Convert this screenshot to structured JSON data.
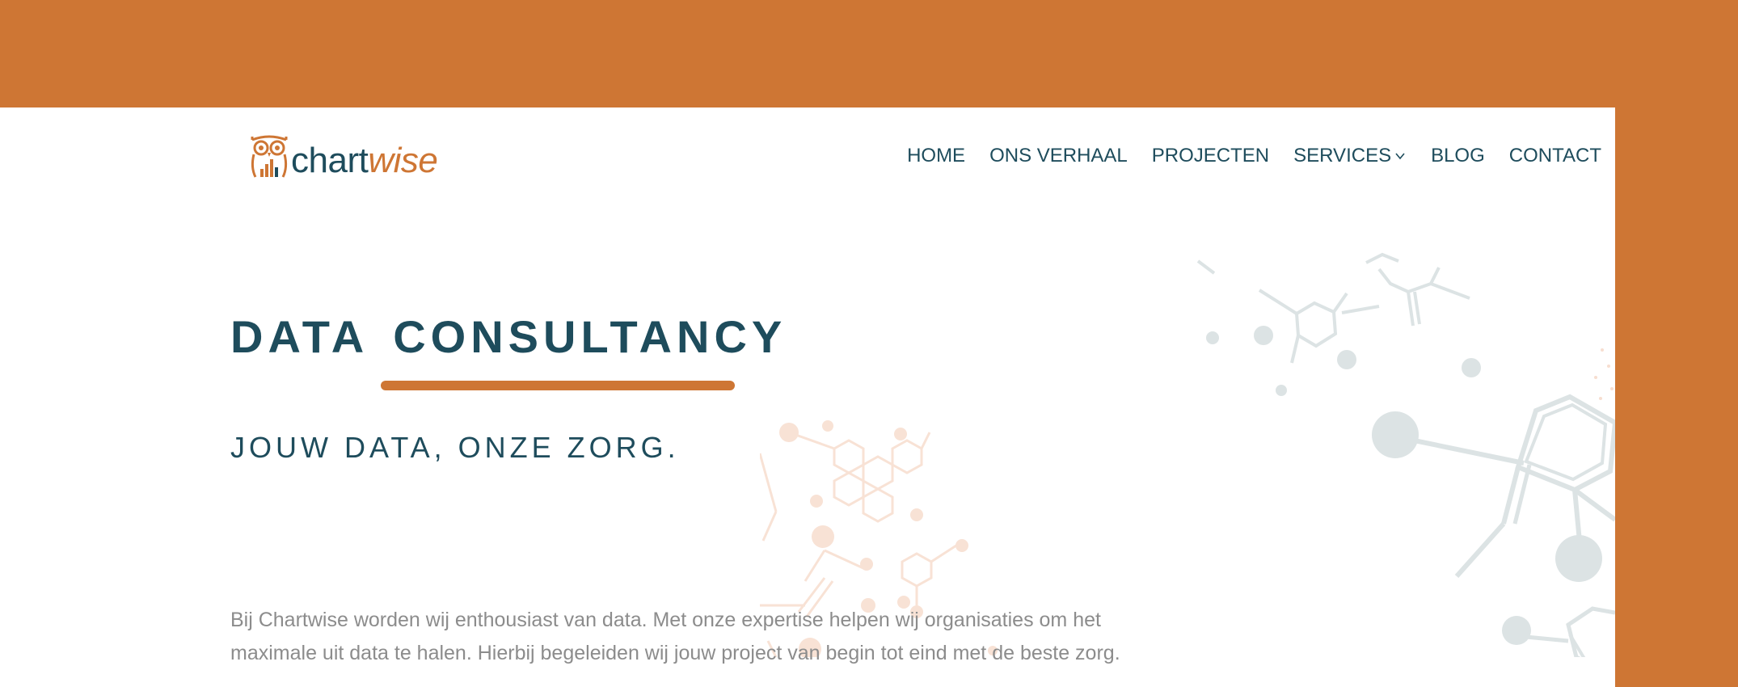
{
  "brand": {
    "logo_text_primary": "chart",
    "logo_text_accent": "wise",
    "logo_icon": "owl-bar-chart-icon"
  },
  "colors": {
    "accent": "#CE7634",
    "primary": "#1E4C5C",
    "body_text": "#8c8c8c",
    "molecule_grey": "#DCE3E4",
    "molecule_peach": "#F7DED0"
  },
  "nav": {
    "items": [
      {
        "label": "HOME"
      },
      {
        "label": "ONS VERHAAL"
      },
      {
        "label": "PROJECTEN"
      },
      {
        "label": "SERVICES",
        "icon": "chevron-down-icon"
      },
      {
        "label": "BLOG"
      },
      {
        "label": "CONTACT"
      }
    ]
  },
  "hero": {
    "title_word1": "DATA",
    "title_word2": "CONSULTANCY",
    "subtitle": "JOUW DATA, ONZE ZORG.",
    "body": "Bij Chartwise worden wij enthousiast van data. Met onze expertise helpen wij organisaties om het maximale uit data te halen. Hierbij begeleiden wij jouw project van begin tot eind met de beste zorg."
  }
}
